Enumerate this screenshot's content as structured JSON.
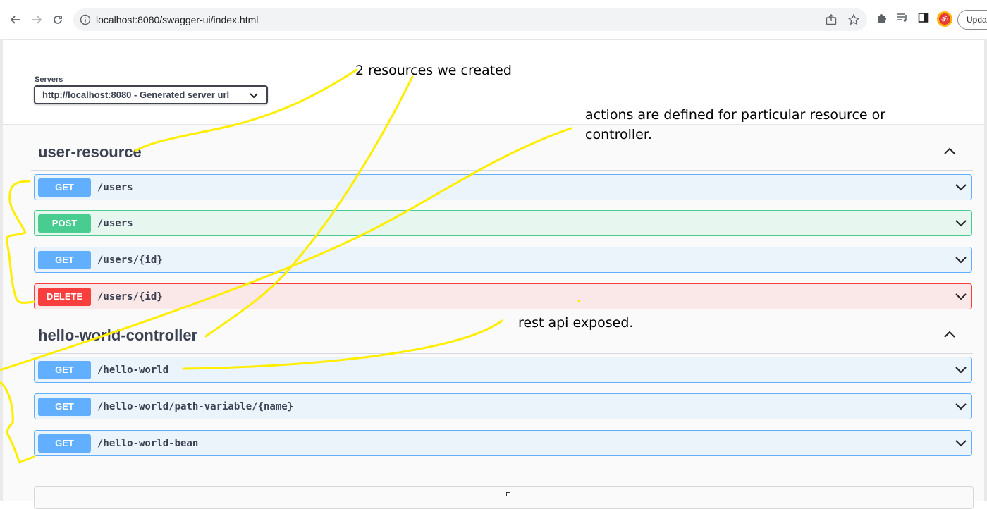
{
  "browser": {
    "url": "localhost:8080/swagger-ui/index.html",
    "update_label": "Update",
    "icons": [
      "back-icon",
      "forward-icon",
      "reload-icon",
      "info-icon",
      "share-icon",
      "star-icon",
      "extensions-icon",
      "reading-list-icon",
      "side-panel-icon",
      "profile-avatar-icon"
    ]
  },
  "servers": {
    "label": "Servers",
    "selected": "http://localhost:8080 - Generated server url"
  },
  "tags": [
    {
      "name": "user-resource",
      "operations": [
        {
          "method": "GET",
          "path": "/users"
        },
        {
          "method": "POST",
          "path": "/users"
        },
        {
          "method": "GET",
          "path": "/users/{id}"
        },
        {
          "method": "DELETE",
          "path": "/users/{id}"
        }
      ]
    },
    {
      "name": "hello-world-controller",
      "operations": [
        {
          "method": "GET",
          "path": "/hello-world"
        },
        {
          "method": "GET",
          "path": "/hello-world/path-variable/{name}"
        },
        {
          "method": "GET",
          "path": "/hello-world-bean"
        }
      ]
    }
  ],
  "annotations": {
    "resources_note": "2 resources we created",
    "actions_note_line1": "actions  are defined for particular resource or",
    "actions_note_line2": "controller.",
    "rest_note": "rest api exposed.",
    "highlight_color": "#ffee00"
  },
  "colors": {
    "get": "#61affe",
    "post": "#49cc90",
    "delete": "#f93e3e"
  }
}
